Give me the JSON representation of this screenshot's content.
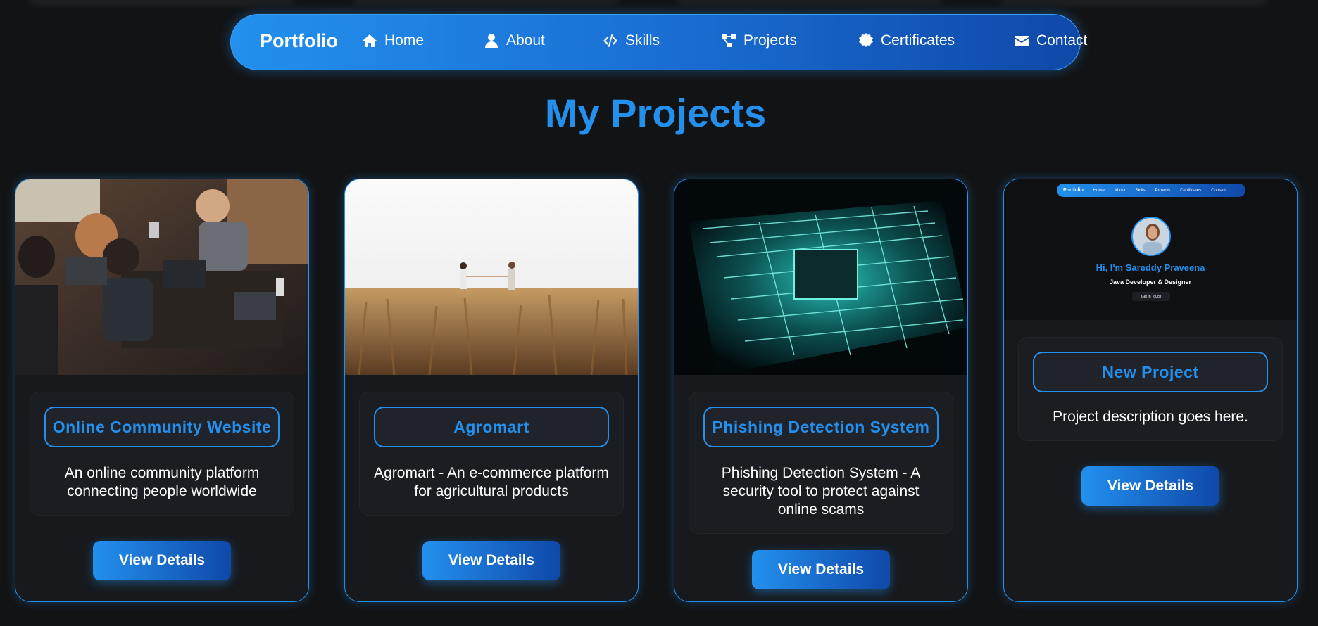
{
  "navbar": {
    "brand": "Portfolio",
    "items": [
      {
        "label": "Home",
        "icon": "home-icon"
      },
      {
        "label": "About",
        "icon": "user-icon"
      },
      {
        "label": "Skills",
        "icon": "code-icon"
      },
      {
        "label": "Projects",
        "icon": "project-diagram-icon"
      },
      {
        "label": "Certificates",
        "icon": "certificate-icon"
      },
      {
        "label": "Contact",
        "icon": "envelope-icon"
      }
    ]
  },
  "page": {
    "title": "My Projects"
  },
  "projects": [
    {
      "title": "Online Community Website",
      "description": "An online community platform connecting people worldwide",
      "button": "View Details",
      "image": "team-working-on-laptops-photo"
    },
    {
      "title": "Agromart",
      "description": "Agromart - An e-commerce platform for agricultural products",
      "button": "View Details",
      "image": "wheat-field-handshake-photo"
    },
    {
      "title": "Phishing Detection System",
      "description": "Phishing Detection System - A security tool to protect against online scams",
      "button": "View Details",
      "image": "circuit-board-photo"
    },
    {
      "title": "New Project",
      "description": "Project description goes here.",
      "button": "View Details",
      "image": "portfolio-screenshot-preview"
    }
  ],
  "preview": {
    "brand": "Portfolio",
    "nav": [
      "Home",
      "About",
      "Skills",
      "Projects",
      "Certificates",
      "Contact"
    ],
    "greeting": "Hi, I'm Sareddy Praveena",
    "role": "Java Developer & Designer",
    "cta": "Get In Touch"
  },
  "colors": {
    "accent": "#2390ee",
    "background": "#121314",
    "card": "#17191c"
  }
}
